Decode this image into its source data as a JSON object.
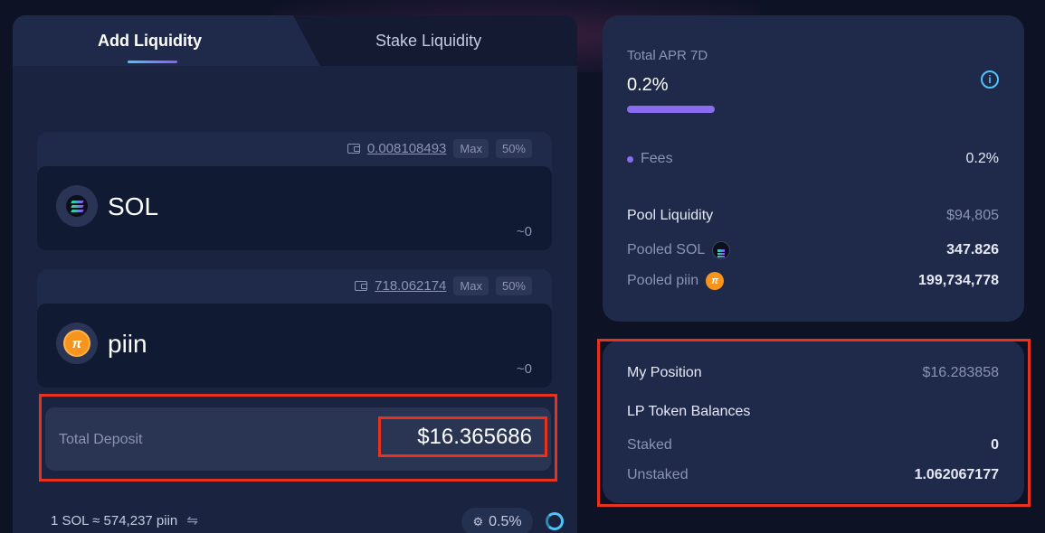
{
  "tabs": {
    "add": "Add Liquidity",
    "stake": "Stake Liquidity"
  },
  "tokens": [
    {
      "symbol": "SOL",
      "balance": "0.008108493",
      "max": "Max",
      "half": "50%",
      "approx": "~0",
      "icon": "sol-icon"
    },
    {
      "symbol": "piin",
      "balance": "718.062174",
      "max": "Max",
      "half": "50%",
      "approx": "~0",
      "icon": "piin-icon"
    }
  ],
  "deposit": {
    "label": "Total Deposit",
    "value": "$16.365686"
  },
  "rate": {
    "text": "1 SOL ≈ 574,237 piin",
    "swap_glyph": "⇋"
  },
  "slippage": {
    "icon_glyph": "⚙",
    "value": "0.5%"
  },
  "apr": {
    "label": "Total APR 7D",
    "value": "0.2%",
    "info_glyph": "i",
    "fees_label": "Fees",
    "fees_value": "0.2%",
    "bar_fraction": 1.0
  },
  "pool": {
    "liquidity_label": "Pool Liquidity",
    "liquidity_value": "$94,805",
    "pooled_sol_label": "Pooled SOL",
    "pooled_sol_value": "347.826",
    "pooled_piin_label": "Pooled piin",
    "pooled_piin_value": "199,734,778",
    "piin_glyph": "π"
  },
  "position": {
    "label": "My Position",
    "value": "$16.283858",
    "lp_label": "LP Token Balances",
    "staked_label": "Staked",
    "staked_value": "0",
    "unstaked_label": "Unstaked",
    "unstaked_value": "1.062067177"
  },
  "colors": {
    "accent": "#8b6cf0",
    "cyan": "#4fc3f7",
    "highlight": "#e8321e"
  }
}
